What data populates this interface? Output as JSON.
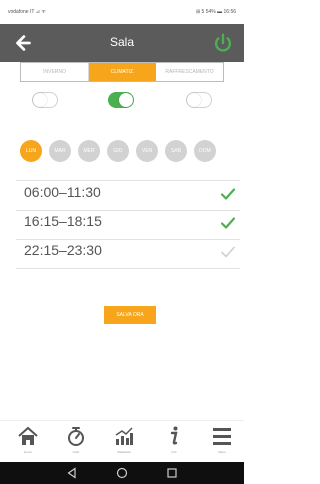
{
  "status_bar": {
    "left": "vodafone IT ⊿ ᯤ",
    "right": "⊞ 5 54% ▬ 16:56"
  },
  "header": {
    "title": "Sala",
    "back_icon": "back-arrow-icon",
    "power_icon": "power-icon",
    "power_color": "#4caf50"
  },
  "mode_tabs": [
    {
      "label": "INVERNO"
    },
    {
      "label": "CLIMATIZ.",
      "active": true
    },
    {
      "label": "RAFFRESCAMENTO"
    }
  ],
  "toggles": [
    {
      "on": false
    },
    {
      "on": true
    },
    {
      "on": false
    }
  ],
  "days": [
    {
      "label": "LUN",
      "selected": true
    },
    {
      "label": "MAR"
    },
    {
      "label": "MER"
    },
    {
      "label": "GIO"
    },
    {
      "label": "VEN"
    },
    {
      "label": "SAB"
    },
    {
      "label": "DOM"
    }
  ],
  "schedule": [
    {
      "time": "06:00–11:30",
      "enabled": true
    },
    {
      "time": "16:15–18:15",
      "enabled": true
    },
    {
      "time": "22:15–23:30",
      "enabled": false
    }
  ],
  "save_button": {
    "label": "SALVA ORA"
  },
  "bottom_nav": [
    {
      "label": "Home",
      "icon": "home-icon"
    },
    {
      "label": "Orari",
      "icon": "timer-icon"
    },
    {
      "label": "Statistiche",
      "icon": "chart-icon"
    },
    {
      "label": "Info",
      "icon": "info-icon"
    },
    {
      "label": "Menu",
      "icon": "menu-icon"
    }
  ],
  "system_nav": {
    "icons": [
      "back-triangle-icon",
      "home-circle-icon",
      "recents-square-icon"
    ]
  },
  "colors": {
    "accent": "#f7a61b",
    "header": "#5b5b5b",
    "ok": "#4caf50"
  }
}
